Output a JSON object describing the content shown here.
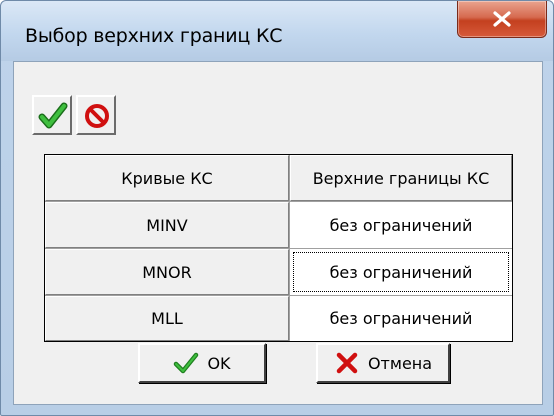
{
  "window": {
    "title": "Выбор верхних границ КС",
    "close_icon": "close-x-icon"
  },
  "toolbar": {
    "accept_icon": "green-checkmark-icon",
    "cancel_icon": "red-prohibited-icon"
  },
  "table": {
    "headers": [
      "Кривые КС",
      "Верхние границы КС"
    ],
    "rows": [
      {
        "curve": "MINV",
        "limit": "без ограничений"
      },
      {
        "curve": "MNOR",
        "limit": "без ограничений"
      },
      {
        "curve": "MLL",
        "limit": "без ограничений"
      }
    ]
  },
  "buttons": {
    "ok_label": "OK",
    "ok_icon": "checkmark-icon",
    "cancel_label": "Отмена",
    "cancel_icon": "red-x-icon"
  },
  "colors": {
    "accept_green": "#2f9e2f",
    "cancel_red": "#d01010",
    "close_red": "#c4401f"
  }
}
